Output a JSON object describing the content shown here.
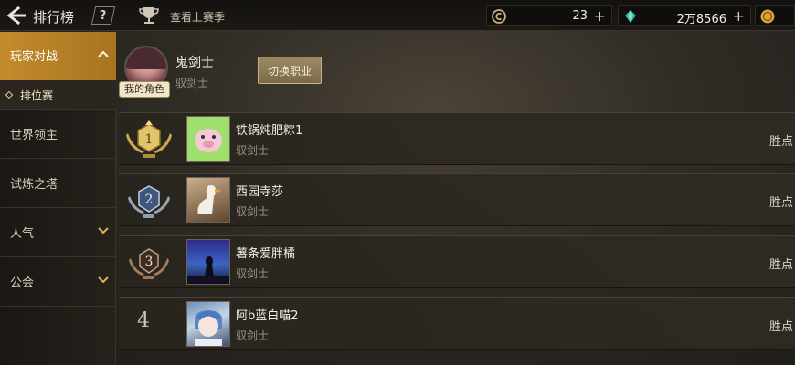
{
  "header": {
    "title": "排行榜",
    "help_label": "?",
    "last_season_label": "查看上赛季",
    "currencies": [
      {
        "icon": "coin-icon",
        "value": "23",
        "plus": "+"
      },
      {
        "icon": "gem-icon",
        "value": "2万8566",
        "plus": "+"
      },
      {
        "icon": "gold-icon",
        "value": "",
        "plus": ""
      }
    ]
  },
  "sidebar": {
    "items": [
      {
        "label": "玩家对战",
        "active": true,
        "expanded": true
      },
      {
        "label": "世界领主"
      },
      {
        "label": "试炼之塔"
      },
      {
        "label": "人气",
        "has_chevron": true
      },
      {
        "label": "公会",
        "has_chevron": true
      }
    ],
    "sub_items": [
      {
        "label": "排位赛",
        "active": true
      }
    ]
  },
  "me": {
    "badge": "我的角色",
    "name": "鬼剑士",
    "class": "驭剑士",
    "switch_label": "切换职业"
  },
  "rankings": [
    {
      "rank": "1",
      "name": "铁锅炖肥粽1",
      "class": "驭剑士",
      "score_label": "胜点",
      "medal": "gold"
    },
    {
      "rank": "2",
      "name": "西园寺莎",
      "class": "驭剑士",
      "score_label": "胜点",
      "medal": "silver"
    },
    {
      "rank": "3",
      "name": "薯条爱胖橘",
      "class": "驭剑士",
      "score_label": "胜点",
      "medal": "bronze"
    },
    {
      "rank": "4",
      "name": "阿b蓝白喵2",
      "class": "驭剑士",
      "score_label": "胜点",
      "medal": ""
    }
  ],
  "colors": {
    "accent": "#c48b2e",
    "background": "#2e2a24",
    "gold": "#d9b45a",
    "silver": "#aab4c4",
    "bronze": "#b88a63"
  }
}
